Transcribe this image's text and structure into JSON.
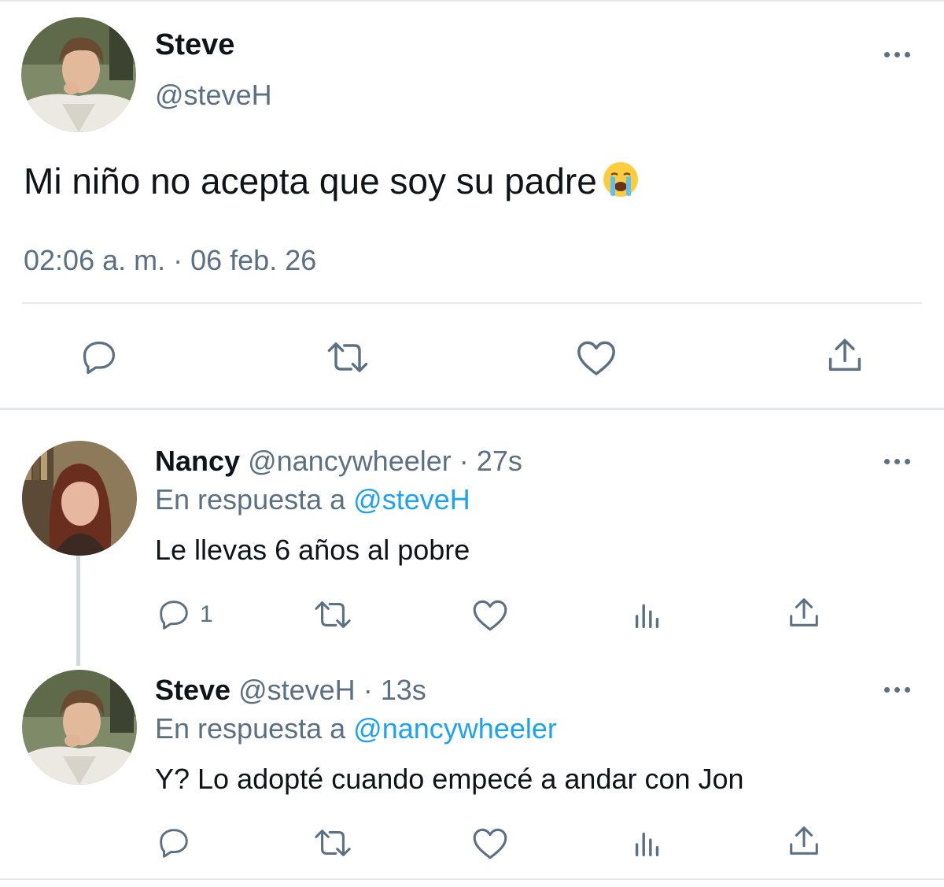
{
  "tweet": {
    "author_name": "Steve",
    "author_handle": "@steveH",
    "text": "Mi niño no acepta que soy su padre",
    "emoji": "loudly-crying-face",
    "timestamp": "02:06 a. m. · 06 feb. 26",
    "actions": [
      "reply-icon",
      "retweet-icon",
      "like-icon",
      "share-icon"
    ]
  },
  "replies": [
    {
      "author_name": "Nancy",
      "author_handle": "@nancywheeler",
      "separator": "·",
      "time": "27s",
      "reply_prefix": "En respuesta a",
      "reply_to": "@steveH",
      "text": "Le llevas 6 años al pobre",
      "reply_count": "1"
    },
    {
      "author_name": "Steve",
      "author_handle": "@steveH",
      "separator": "·",
      "time": "13s",
      "reply_prefix": "En respuesta a",
      "reply_to": "@nancywheeler",
      "text": "Y? Lo adopté cuando empecé a andar con Jon"
    }
  ],
  "colors": {
    "text": "#0f1419",
    "secondary": "#5b7083",
    "mention": "#1da1f2",
    "divider": "#e6e9eb"
  }
}
